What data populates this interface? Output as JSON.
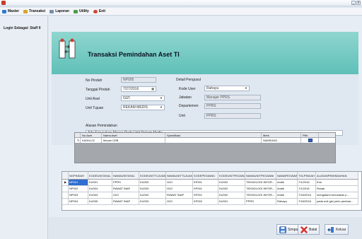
{
  "window": {
    "minimize_glyph": "_",
    "close_glyph": "x"
  },
  "menu": {
    "items": [
      {
        "label": "Master",
        "icon": "master-icon",
        "color": "#2b7bd6"
      },
      {
        "label": "Transaksi",
        "icon": "transaksi-icon",
        "color": "#d9a62b"
      },
      {
        "label": "Laporan",
        "icon": "laporan-icon",
        "color": "#7a8fa8"
      },
      {
        "label": "Utility",
        "icon": "utility-icon",
        "color": "#4f9d4a"
      },
      {
        "label": "Exit",
        "icon": "exit-icon",
        "color": "#d4432e"
      }
    ]
  },
  "sidebar": {
    "login_label": "Login Sebagai: Staff II"
  },
  "banner": {
    "title": "Transaksi Pemindahan Aset TI",
    "color": "#7ccfc7"
  },
  "form": {
    "no_pindah_label": "No Pindah",
    "no_pindah_value": "NP005",
    "tanggal_label": "Tanggal Pindah",
    "tanggal_value": "7/27/2016",
    "unit_asal_label": "Unit Asal",
    "unit_asal_value": "GIZI",
    "unit_tujuan_label": "Unit Tujuan",
    "unit_tujuan_value": "REKAM MEDIS",
    "detail_label": "Detail Pengusul",
    "kode_user_label": "Kode User",
    "kode_user_value": "Rahayu",
    "jabatan_label": "Jabatan",
    "jabatan_value": "Manajer PPRS",
    "departemen_label": "Departemen",
    "departemen_value": "PPRS",
    "unit_label": "Unit",
    "unit_value": "PPRS",
    "alasan_label": "Alasan Pemindahan",
    "alasan_value": "Ada Kerusakan Mouse Pada Unit Rekam Medis"
  },
  "asset_grid": {
    "headers": [
      "No Aset",
      "Nama Aset",
      "Spesifikasi",
      "Merk",
      "Pilih"
    ],
    "rows": [
      {
        "indicator": "✎",
        "no_aset": "KA004-02",
        "nama_aset": "Mouse USB",
        "spesifikasi": "",
        "merk": "SAMSUNG",
        "pilih": true
      }
    ]
  },
  "history_grid": {
    "headers": [
      "NOPINDAH",
      "KODEUNITASAL",
      "NAMAUNITASAL",
      "KODEUNITTUJUAN",
      "NAMAUNITTUJUAN",
      "KODEPEGAWAI",
      "KODEUNITPEGAWAI",
      "NAMAUNITPEGAWAI",
      "NAMAPEGAWAI",
      "TGLPINDAH",
      "ALASANPEMINDAHAN"
    ],
    "rows": [
      [
        "NP001",
        "KU001",
        "PPRS",
        "KU003",
        "GIZI",
        "KP001",
        "KU002",
        "TEKNOLOGI INFOR...",
        "Andik",
        "7/1/2016",
        "Eror"
      ],
      [
        "NP002",
        "KU004",
        "RAWAT INAP",
        "KU003",
        "GIZI",
        "KP001",
        "KU002",
        "TEKNOLOGI INFOR...",
        "Andik",
        "7/1/2016",
        "Rusak"
      ],
      [
        "NP003",
        "KU003",
        "GIZI",
        "KU004",
        "RAWAT INAP",
        "KP001",
        "KU002",
        "TEKNOLOGI INFOR...",
        "Andik",
        "7/18/2016",
        "mengalami kerusakan p..."
      ],
      [
        "NP004",
        "KU005",
        "RAWAT INAP",
        "KU003",
        "GIZI",
        "KP002",
        "KU001",
        "PPRS",
        "Rahayu",
        "7/18/2016",
        "pada unit gizi perlu pembar..."
      ]
    ],
    "selected_row_indicator": "▶"
  },
  "buttons": {
    "simpan": "Simpan",
    "batal": "Batal",
    "keluar": "Keluar"
  }
}
